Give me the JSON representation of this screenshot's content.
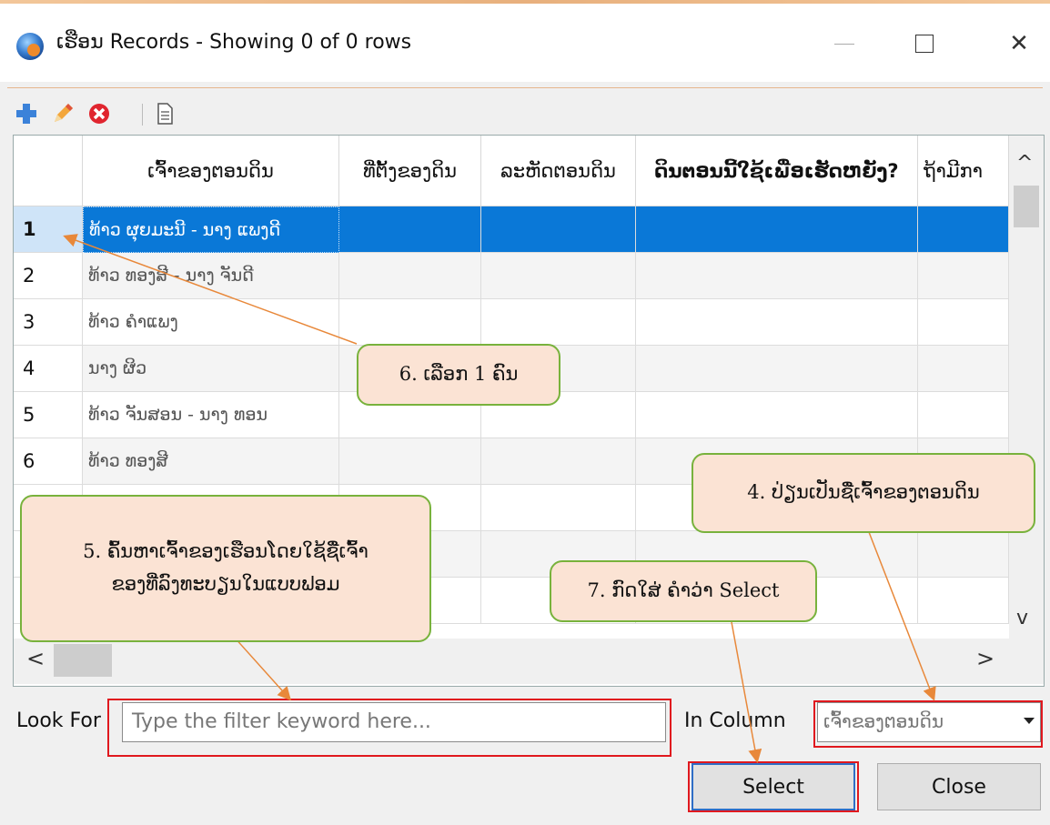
{
  "window": {
    "title": "ເຮືອນ Records - Showing 0 of 0 rows",
    "min_glyph": "—",
    "close_glyph": "✕"
  },
  "toolbar": {
    "add_icon": "add-plus-icon",
    "edit_icon": "pencil-icon",
    "delete_icon": "delete-x-icon",
    "doc_icon": "document-icon"
  },
  "grid": {
    "columns": [
      "ເຈົ້າຂອງຕອນດິນ",
      "ທີ່ຕັ້ງຂອງດິນ",
      "ລະຫັດຕອນດິນ",
      "ດິນຕອນນີ້ໃຊ້ເພື່ອເຮັດຫຍັງ?",
      "ຖ້າມີກາ"
    ],
    "rows": [
      {
        "num": "1",
        "name": "ທ້າວ ຜຸຍມະນີ - ນາງ ແພງດີ",
        "selected": true
      },
      {
        "num": "2",
        "name": "ທ້າວ ທອງສີ - ນາງ ຈັນດີ"
      },
      {
        "num": "3",
        "name": "ທ້າວ ຄຳແພງ"
      },
      {
        "num": "4",
        "name": "ນາງ ຜິວ"
      },
      {
        "num": "5",
        "name": "ທ້າວ ຈັນສອນ - ນາງ ທອນ"
      },
      {
        "num": "6",
        "name": "ທ້າວ ທອງສີ"
      },
      {
        "num": "",
        "name": ""
      },
      {
        "num": "",
        "name": ""
      },
      {
        "num": "",
        "name": ""
      }
    ],
    "scroll_up": "^",
    "scroll_down": "v",
    "scroll_left": "<",
    "scroll_right": ">"
  },
  "filter": {
    "look_for_label": "Look For",
    "placeholder": "Type the filter keyword here...",
    "in_column_label": "In Column",
    "column_value": "ເຈົ້າຂອງຕອນດິນ"
  },
  "buttons": {
    "select": "Select",
    "close": "Close"
  },
  "callouts": {
    "c4": "4. ປ່ຽນເປັນຊື່ເຈົ້າຂອງຕອນດິນ",
    "c5_line1": "5. ຄົ້ນຫາເຈົ້າຂອງເຮືອນໂດຍໃຊ້ຊື່ເຈົ້າ",
    "c5_line2": "ຂອງທີ່ລົງທະບຽນໃນແບບຟອມ",
    "c6": "6. ເລືອກ 1 ຄົນ",
    "c7": "7. ກົດໃສ່ ຄຳວ່າ Select"
  },
  "colors": {
    "selection": "#0a78d7",
    "callout_fill": "#fbe3d4",
    "callout_border": "#78b23c",
    "highlight_red": "#e0181e",
    "arrow": "#e8883a"
  }
}
